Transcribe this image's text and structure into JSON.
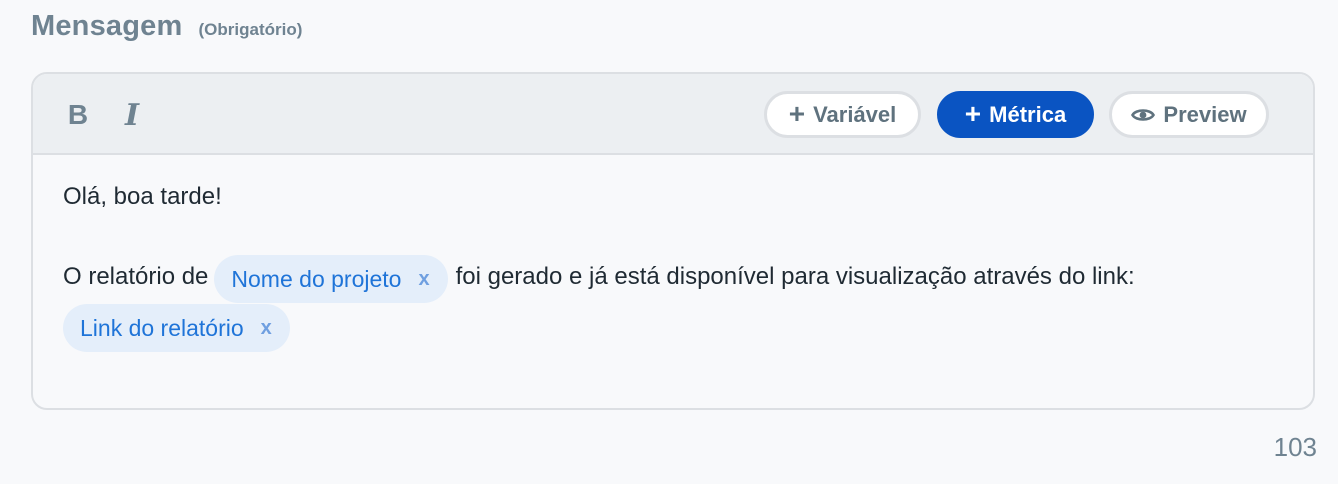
{
  "field": {
    "label": "Mensagem",
    "hint": "(Obrigatório)",
    "char_count": "103"
  },
  "toolbar": {
    "bold_label": "B",
    "italic_label": "I",
    "variable_button": "Variável",
    "metric_button": "Métrica",
    "preview_button": "Preview"
  },
  "message": {
    "greeting": "Olá, boa tarde!",
    "text_before_chip": "O relatório de",
    "chip_project": "Nome do projeto",
    "text_after_chip": "foi gerado e já está disponível para visualização através do link:",
    "chip_link": "Link do relatório",
    "chip_remove": "x"
  },
  "colors": {
    "primary": "#0a54c2",
    "chip_bg": "#e4eefa",
    "chip_text": "#1f74d8",
    "label": "#6f8391"
  },
  "icons": {
    "plus": "plus-icon",
    "eye": "eye-icon"
  }
}
